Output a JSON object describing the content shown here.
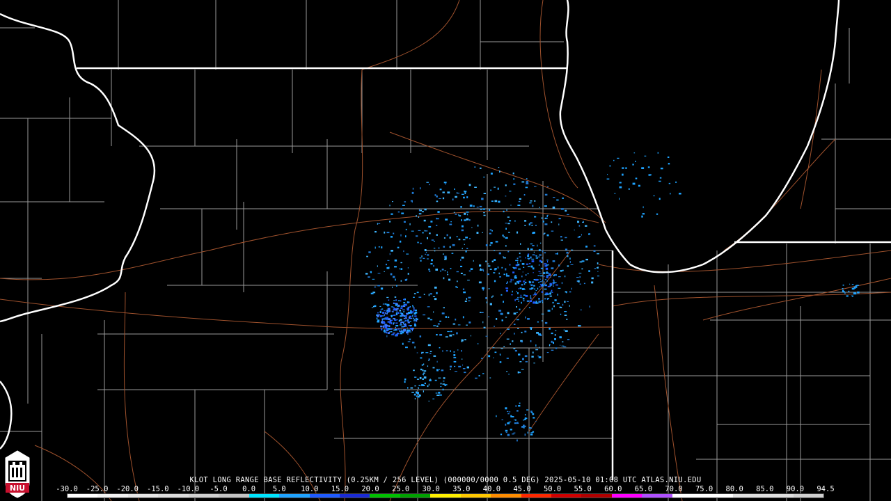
{
  "product": {
    "caption": "KLOT LONG RANGE BASE REFLECTIVITY (0.25KM / 256 LEVEL) (000000/0000 0.5 DEG) 2025-05-10 01:08 UTC  ATLAS.NIU.EDU"
  },
  "logo": {
    "text": "NIU",
    "color": "#c8102e"
  },
  "colors": {
    "background": "#000000",
    "state_border": "#ffffff",
    "county_border": "#9a9a9a",
    "highway": "#a0522d"
  },
  "scale": {
    "labels": [
      "-30.0",
      "-25.0",
      "-20.0",
      "-15.0",
      "-10.0",
      "-5.0",
      "0.0",
      "5.0",
      "10.0",
      "15.0",
      "20.0",
      "25.0",
      "30.0",
      "35.0",
      "40.0",
      "45.0",
      "50.0",
      "55.0",
      "60.0",
      "65.0",
      "70.0",
      "75.0",
      "80.0",
      "85.0",
      "90.0",
      "94.5"
    ],
    "segment_colors": [
      "#ffffff",
      "#f2f2f2",
      "#e6e6e6",
      "#dcdcdc",
      "#d0d0d0",
      "#c4c4c4",
      "#00e5ff",
      "#1fa3ff",
      "#1f5bff",
      "#1a2bd6",
      "#00c000",
      "#00a000",
      "#fff000",
      "#ffc800",
      "#ff8c00",
      "#ff2800",
      "#d00000",
      "#b00000",
      "#ff00ff",
      "#b050ff",
      "#ffffff",
      "#ffffff",
      "#e0e0e0",
      "#e0e0e0",
      "#d0d0d0"
    ]
  }
}
